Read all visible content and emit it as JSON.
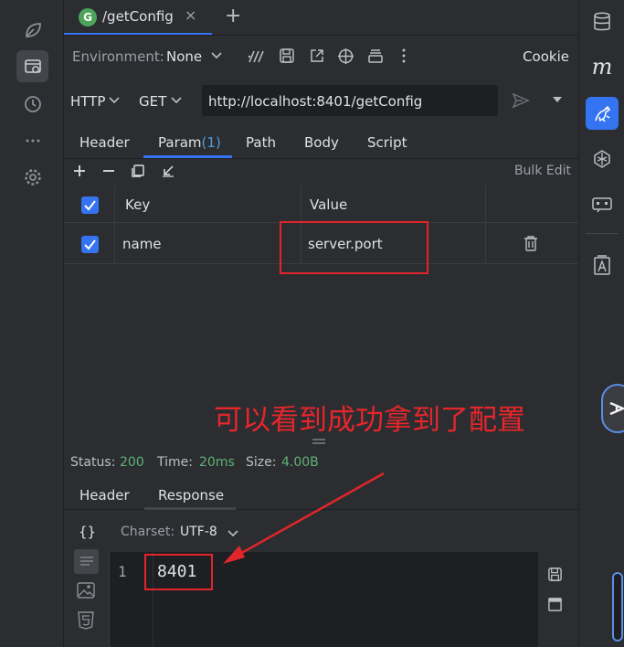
{
  "tab": {
    "badge": "G",
    "title": "/getConfig",
    "close": "×",
    "add": "+"
  },
  "env": {
    "label": "Environment:",
    "value": "None",
    "cookie": "Cookie"
  },
  "request": {
    "protocol": "HTTP",
    "method": "GET",
    "url": "http://localhost:8401/getConfig"
  },
  "req_tabs": [
    {
      "label": "Header"
    },
    {
      "label": "Param",
      "count": "(1)"
    },
    {
      "label": "Path"
    },
    {
      "label": "Body"
    },
    {
      "label": "Script"
    }
  ],
  "param_tools": {
    "bulk_edit": "Bulk Edit"
  },
  "param_table": {
    "headers": {
      "key": "Key",
      "value": "Value"
    },
    "rows": [
      {
        "key": "name",
        "value": "server.port",
        "checked": true
      }
    ]
  },
  "annotation": "可以看到成功拿到了配置",
  "status": {
    "status_label": "Status:",
    "status_value": "200",
    "time_label": "Time:",
    "time_value": "20ms",
    "size_label": "Size:",
    "size_value": "4.00B"
  },
  "resp_tabs": [
    {
      "label": "Header"
    },
    {
      "label": "Response"
    }
  ],
  "response": {
    "charset_label": "Charset:",
    "charset_value": "UTF-8",
    "line_number": "1",
    "body": "8401"
  },
  "colors": {
    "accent": "#3574f0",
    "annotation_red": "#e0262a",
    "success_green": "#5fb374",
    "tab_badge": "#4ea35a"
  }
}
